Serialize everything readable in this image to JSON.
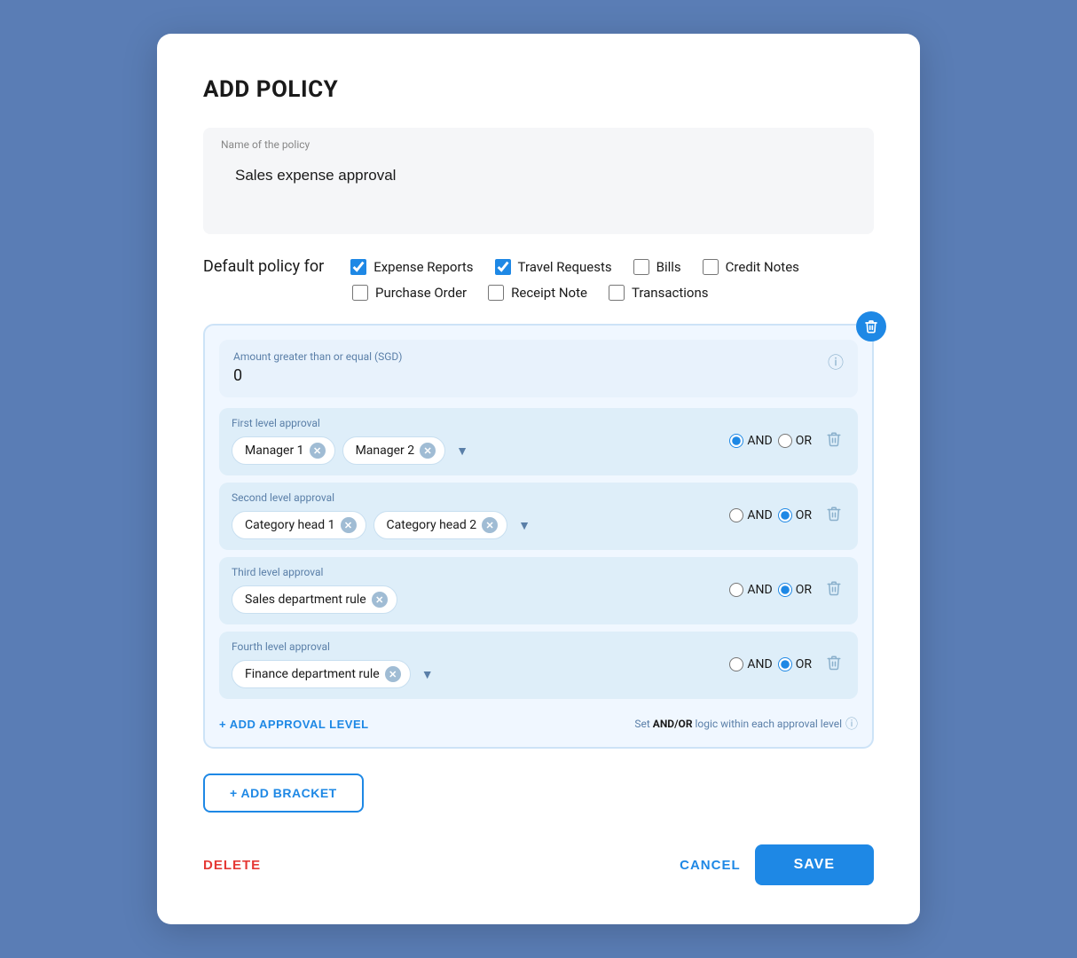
{
  "modal": {
    "title": "ADD POLICY",
    "policy_name_label": "Name of the policy",
    "policy_name_value": "Sales expense approval"
  },
  "default_policy": {
    "label": "Default policy for",
    "checkboxes": [
      {
        "id": "expense-reports",
        "label": "Expense Reports",
        "checked": true
      },
      {
        "id": "travel-requests",
        "label": "Travel Requests",
        "checked": true
      },
      {
        "id": "bills",
        "label": "Bills",
        "checked": false
      },
      {
        "id": "credit-notes",
        "label": "Credit Notes",
        "checked": false
      },
      {
        "id": "purchase-order",
        "label": "Purchase Order",
        "checked": false
      },
      {
        "id": "receipt-note",
        "label": "Receipt Note",
        "checked": false
      },
      {
        "id": "transactions",
        "label": "Transactions",
        "checked": false
      }
    ]
  },
  "bracket": {
    "amount_label": "Amount greater than or equal (SGD)",
    "amount_value": "0",
    "approval_levels": [
      {
        "id": "first",
        "label": "First level approval",
        "tags": [
          "Manager 1",
          "Manager 2"
        ],
        "and_selected": true,
        "or_selected": false
      },
      {
        "id": "second",
        "label": "Second level approval",
        "tags": [
          "Category head 1",
          "Category head 2"
        ],
        "and_selected": false,
        "or_selected": true
      },
      {
        "id": "third",
        "label": "Third level approval",
        "tags": [
          "Sales department rule"
        ],
        "and_selected": false,
        "or_selected": true
      },
      {
        "id": "fourth",
        "label": "Fourth level approval",
        "tags": [
          "Finance department rule"
        ],
        "and_selected": false,
        "or_selected": true
      }
    ],
    "add_approval_label": "+ ADD APPROVAL LEVEL",
    "and_or_hint": "Set AND/OR logic within each approval level"
  },
  "footer": {
    "add_bracket_label": "+ ADD BRACKET",
    "delete_label": "DELETE",
    "cancel_label": "CANCEL",
    "save_label": "SAVE"
  }
}
